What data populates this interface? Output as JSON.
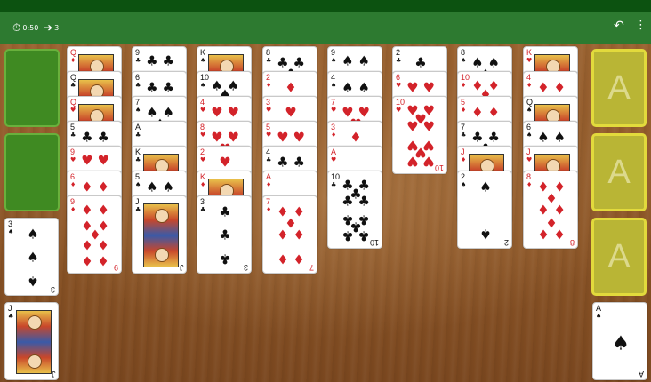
{
  "toolbar": {
    "timer": "0:50",
    "moves": "3",
    "timer_icon": "stopwatch-icon",
    "moves_icon": "arrow-right-icon",
    "undo_icon": "undo-icon",
    "menu_icon": "more-vertical-icon"
  },
  "colors": {
    "felt_bar": "#2d7a30",
    "status_bar": "#0c5210",
    "free_cell": "#3f8a22",
    "foundation": "#b9b535",
    "red_suit": "#d3232a"
  },
  "free_cells": [
    {
      "card": null
    },
    {
      "card": null
    },
    {
      "card": {
        "rank": "3",
        "suit": "♠"
      }
    },
    {
      "card": {
        "rank": "J",
        "suit": "♣"
      }
    }
  ],
  "foundations": [
    {
      "label": "A",
      "card": null
    },
    {
      "label": "A",
      "card": null
    },
    {
      "label": "A",
      "card": null
    },
    {
      "label": "A",
      "card": {
        "rank": "A",
        "suit": "♠"
      }
    }
  ],
  "tableau": [
    [
      {
        "rank": "Q",
        "suit": "♦"
      },
      {
        "rank": "Q",
        "suit": "♣"
      },
      {
        "rank": "Q",
        "suit": "♥"
      },
      {
        "rank": "5",
        "suit": "♣"
      },
      {
        "rank": "9",
        "suit": "♥"
      },
      {
        "rank": "6",
        "suit": "♦"
      },
      {
        "rank": "9",
        "suit": "♦"
      }
    ],
    [
      {
        "rank": "9",
        "suit": "♣"
      },
      {
        "rank": "6",
        "suit": "♣"
      },
      {
        "rank": "7",
        "suit": "♠"
      },
      {
        "rank": "A",
        "suit": "♣"
      },
      {
        "rank": "K",
        "suit": "♣"
      },
      {
        "rank": "5",
        "suit": "♠"
      },
      {
        "rank": "J",
        "suit": "♣"
      }
    ],
    [
      {
        "rank": "K",
        "suit": "♠"
      },
      {
        "rank": "10",
        "suit": "♠"
      },
      {
        "rank": "4",
        "suit": "♥"
      },
      {
        "rank": "8",
        "suit": "♥"
      },
      {
        "rank": "2",
        "suit": "♥"
      },
      {
        "rank": "K",
        "suit": "♦"
      },
      {
        "rank": "3",
        "suit": "♣"
      }
    ],
    [
      {
        "rank": "8",
        "suit": "♣"
      },
      {
        "rank": "2",
        "suit": "♦"
      },
      {
        "rank": "3",
        "suit": "♥"
      },
      {
        "rank": "5",
        "suit": "♥"
      },
      {
        "rank": "4",
        "suit": "♣"
      },
      {
        "rank": "A",
        "suit": "♦"
      },
      {
        "rank": "7",
        "suit": "♦"
      }
    ],
    [
      {
        "rank": "9",
        "suit": "♠"
      },
      {
        "rank": "4",
        "suit": "♠"
      },
      {
        "rank": "7",
        "suit": "♥"
      },
      {
        "rank": "3",
        "suit": "♦"
      },
      {
        "rank": "A",
        "suit": "♥"
      },
      {
        "rank": "10",
        "suit": "♣"
      }
    ],
    [
      {
        "rank": "2",
        "suit": "♣"
      },
      {
        "rank": "6",
        "suit": "♥"
      },
      {
        "rank": "10",
        "suit": "♥"
      }
    ],
    [
      {
        "rank": "8",
        "suit": "♠"
      },
      {
        "rank": "10",
        "suit": "♦"
      },
      {
        "rank": "5",
        "suit": "♦"
      },
      {
        "rank": "7",
        "suit": "♣"
      },
      {
        "rank": "J",
        "suit": "♦"
      },
      {
        "rank": "2",
        "suit": "♠"
      }
    ],
    [
      {
        "rank": "K",
        "suit": "♥"
      },
      {
        "rank": "4",
        "suit": "♦"
      },
      {
        "rank": "Q",
        "suit": "♠"
      },
      {
        "rank": "6",
        "suit": "♠"
      },
      {
        "rank": "J",
        "suit": "♥"
      },
      {
        "rank": "8",
        "suit": "♦"
      }
    ]
  ]
}
